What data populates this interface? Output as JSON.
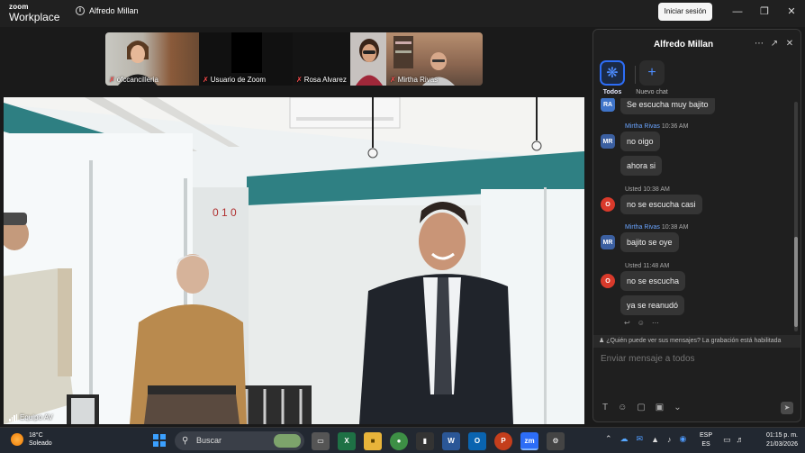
{
  "app": {
    "brand_line1": "zoom",
    "brand_line2": "Workplace",
    "host_name": "Alfredo Millan",
    "signin_label": "Iniciar sesión"
  },
  "gallery": [
    {
      "name": "ofccancilleria",
      "muted": true
    },
    {
      "name": "Usuario de Zoom",
      "muted": true
    },
    {
      "name": "Rosa Alvarez",
      "muted": true
    },
    {
      "name": "Mirtha Rivas",
      "muted": true
    }
  ],
  "main_video": {
    "label": "Equipo AV"
  },
  "chat": {
    "title": "Alfredo Millan",
    "tabs": [
      {
        "label": "Todos",
        "icon": "paw-icon",
        "active": true
      },
      {
        "label": "Nuevo chat",
        "icon": "plus-icon",
        "active": false
      }
    ],
    "messages": [
      {
        "avatar": "RA",
        "sender": "",
        "time": "",
        "text": "Se escucha muy bajito"
      },
      {
        "avatar": "MR",
        "sender": "Mirtha Rivas",
        "time": "10:36 AM",
        "text": "no oigo"
      },
      {
        "avatar": "",
        "sender": "",
        "time": "",
        "text": "ahora si"
      },
      {
        "avatar": "O",
        "sender": "Usted",
        "time": "10:38 AM",
        "text": "no se escucha casi"
      },
      {
        "avatar": "MR",
        "sender": "Mirtha Rivas",
        "time": "10:38 AM",
        "text": "bajito se oye"
      },
      {
        "avatar": "O",
        "sender": "Usted",
        "time": "11:48 AM",
        "text": "no se escucha"
      },
      {
        "avatar": "",
        "sender": "",
        "time": "",
        "text": "ya se reanudó"
      }
    ],
    "notice": "¿Quién puede ver sus mensajes? La grabación está habilitada",
    "compose_placeholder": "Enviar mensaje a todos"
  },
  "taskbar": {
    "temperature": "18°C",
    "weather": "Soleado",
    "search_placeholder": "Buscar",
    "language_top": "ESP",
    "language_bottom": "ES",
    "time": "01:15 p. m.",
    "date": "21/03/2026"
  },
  "colors": {
    "accent": "#2d6df6",
    "sender": "#6aa4ff",
    "mute": "#ff4d4d"
  }
}
